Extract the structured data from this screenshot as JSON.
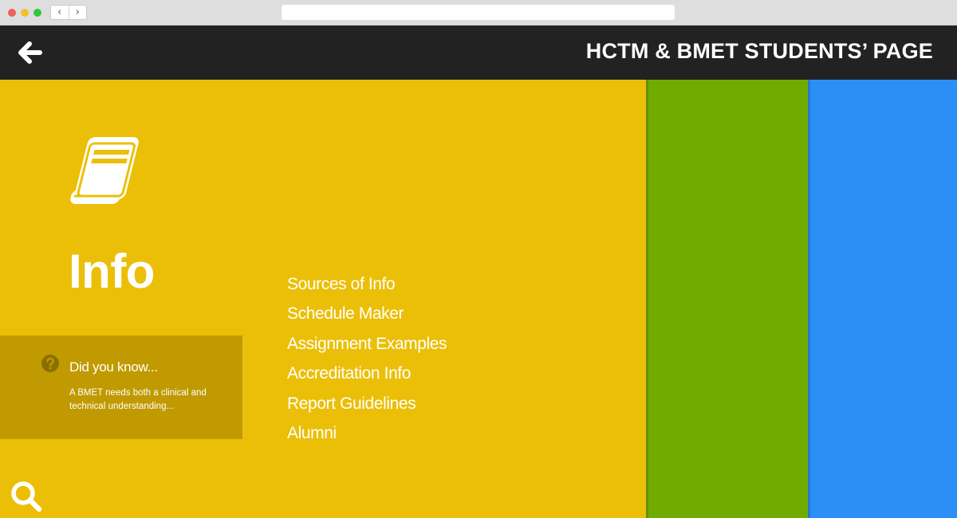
{
  "browser": {
    "back_glyph": "‹",
    "forward_glyph": "›"
  },
  "header": {
    "title": "HCTM & BMET STUDENTS’ PAGE",
    "back_icon": "left-arrow-icon"
  },
  "info_panel": {
    "icon": "book-icon",
    "heading": "Info",
    "links": [
      "Sources of Info",
      "Schedule Maker",
      "Assignment Examples",
      "Accreditation Info",
      "Report Guidelines",
      "Alumni"
    ],
    "did_you_know": {
      "icon": "question-circle-icon",
      "title": "Did you know...",
      "text": "A BMET needs both a clinical and technical understanding..."
    },
    "search_icon": "search-icon"
  },
  "colors": {
    "header_bg": "#222222",
    "info_panel": "#ebbf07",
    "did_you_know_bg": "#c09a00",
    "green_panel": "#71ab00",
    "blue_panel": "#2c8ff5"
  }
}
